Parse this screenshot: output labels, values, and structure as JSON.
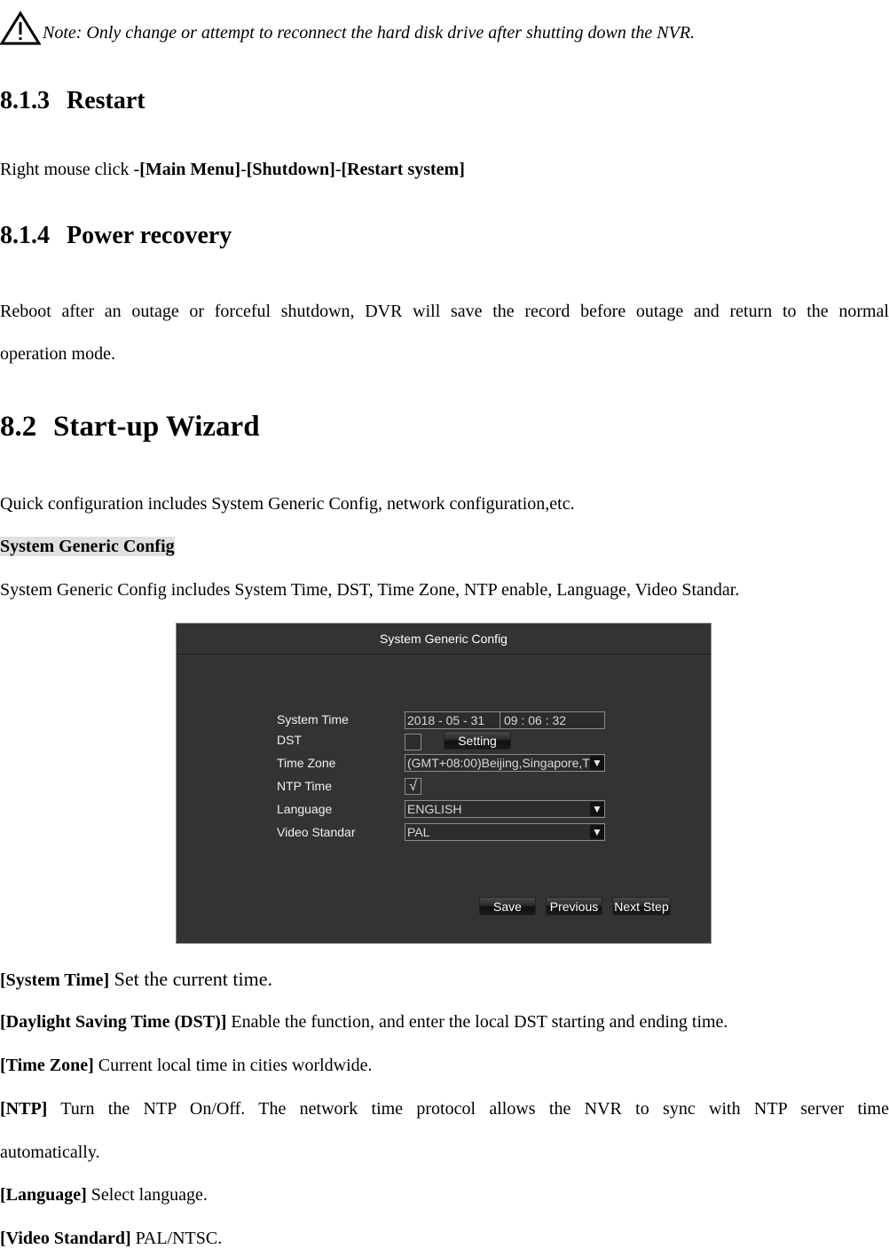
{
  "note": {
    "icon": "warning-triangle-icon",
    "text": "Note: Only change or attempt to reconnect the hard disk drive after shutting down the NVR."
  },
  "sections": {
    "restart": {
      "number": "8.1.3",
      "title": "Restart",
      "body_prefix": "Right mouse click -",
      "path": [
        "[Main Menu]",
        "[Shutdown]",
        "[Restart system]"
      ],
      "separator": "-"
    },
    "power_recovery": {
      "number": "8.1.4",
      "title": "Power recovery",
      "body_line1": "Reboot after an outage or forceful shutdown, DVR will save the record before outage and return to the normal",
      "body_line2": "operation mode."
    },
    "wizard": {
      "number": "8.2",
      "title": "Start-up Wizard",
      "intro": "Quick configuration includes System Generic Config, network configuration,etc.",
      "subheading": "System Generic Config",
      "subintro": "System Generic Config includes System Time, DST, Time Zone, NTP enable, Language, Video Standar."
    }
  },
  "dialog": {
    "title": "System Generic Config",
    "labels": {
      "system_time": "System Time",
      "dst": "DST",
      "time_zone": "Time Zone",
      "ntp_time": "NTP Time",
      "language": "Language",
      "video_standard": "Video Standar"
    },
    "system_time": {
      "date": "2018  - 05 - 31",
      "time": "09 : 06 : 32"
    },
    "dst_checked": false,
    "dst_setting_label": "Setting",
    "time_zone_value": "(GMT+08:00)Beijing,Singapore,T",
    "ntp_checked": true,
    "ntp_check_glyph": "√",
    "language_value": "ENGLISH",
    "video_standard_value": "PAL",
    "dropdown_glyph": "▼",
    "buttons": {
      "save": "Save",
      "previous": "Previous",
      "next": "Next Step"
    }
  },
  "definitions": [
    {
      "term": "[System Time]",
      "text": " Set the current time."
    },
    {
      "term": "[Daylight Saving Time (DST)]",
      "text": " Enable the function, and enter the local DST starting and ending time."
    },
    {
      "term": "[Time Zone]",
      "text": " Current local time in cities worldwide."
    },
    {
      "term": "[NTP]",
      "text": " Turn the NTP On/Off. The network time protocol allows the NVR to sync with NTP server time",
      "text_line2": "automatically."
    },
    {
      "term": "[Language]",
      "text": " Select language."
    },
    {
      "term": "[Video Standard]",
      "text": " PAL/NTSC."
    }
  ]
}
